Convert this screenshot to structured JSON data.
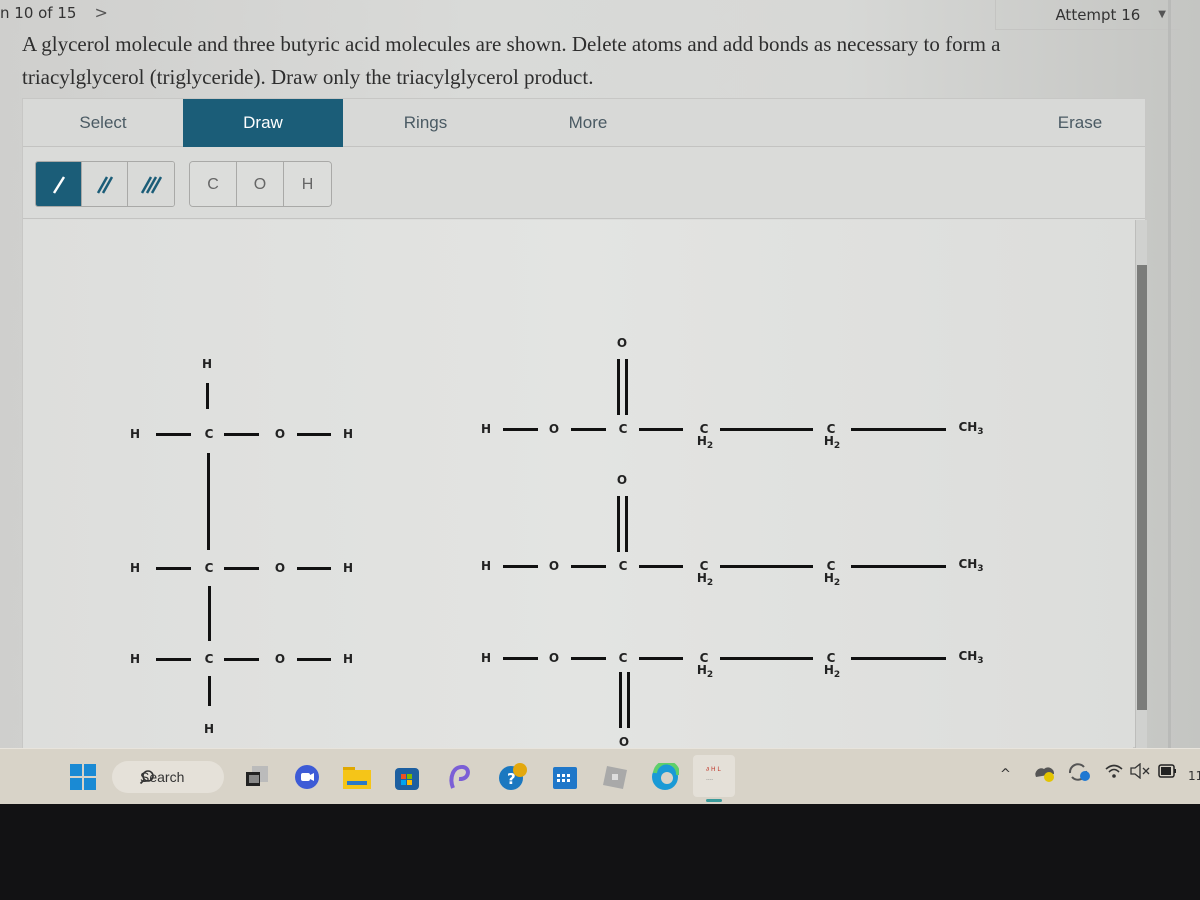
{
  "header": {
    "question_nav": "n 10 of 15",
    "next_icon": "chevron-right-icon",
    "attempt_label": "Attempt 16"
  },
  "prompt": {
    "text": "A glycerol molecule and three butyric acid molecules are shown. Delete atoms and add bonds as necessary to form a triacylglycerol (triglyceride). Draw only the triacylglycerol product."
  },
  "editor": {
    "tabs": [
      {
        "label": "Select",
        "active": false
      },
      {
        "label": "Draw",
        "active": true
      },
      {
        "label": "Rings",
        "active": false
      },
      {
        "label": "More",
        "active": false
      },
      {
        "label": "Erase",
        "active": false
      }
    ],
    "bond_tools": [
      "single-bond",
      "double-bond",
      "triple-bond"
    ],
    "active_bond_tool": "single-bond",
    "atom_tools": [
      "C",
      "O",
      "H"
    ],
    "accent_color": "#1b5d78"
  },
  "molecules": {
    "glycerol": {
      "rows": [
        {
          "left_H": "H",
          "C": "C",
          "O": "O",
          "right_H": "H"
        },
        {
          "left_H": "H",
          "C": "C",
          "O": "O",
          "right_H": "H"
        },
        {
          "left_H": "H",
          "C": "C",
          "O": "O",
          "right_H": "H"
        }
      ],
      "top_H": "H",
      "bottom_H": "H"
    },
    "butyric_acids": [
      {
        "H": "H",
        "O": "O",
        "C": "C",
        "carbonyl_O": "O",
        "ch2_a": "C",
        "ch2_a_h": "H",
        "ch2_b": "C",
        "ch2_b_h": "H",
        "ch3": "CH",
        "ch3_sub": "3",
        "h2_sub": "2"
      },
      {
        "H": "H",
        "O": "O",
        "C": "C",
        "carbonyl_O": "O",
        "ch2_a": "C",
        "ch2_a_h": "H",
        "ch2_b": "C",
        "ch2_b_h": "H",
        "ch3": "CH",
        "ch3_sub": "3",
        "h2_sub": "2"
      },
      {
        "H": "H",
        "O": "O",
        "C": "C",
        "carbonyl_O": "O",
        "ch2_a": "C",
        "ch2_a_h": "H",
        "ch2_b": "C",
        "ch2_b_h": "H",
        "ch3": "CH",
        "ch3_sub": "3",
        "h2_sub": "2"
      }
    ]
  },
  "taskbar": {
    "search_label": "Search",
    "apps": [
      "start-icon",
      "task-view-icon",
      "meet-icon",
      "file-explorer-icon",
      "store-icon",
      "copilot-icon",
      "help-icon",
      "calendar-icon",
      "roblox-icon",
      "edge-icon",
      "active-window-thumbnail"
    ],
    "tray": [
      "chevron-up-icon",
      "onedrive-icon",
      "sync-icon",
      "wifi-icon",
      "mute-icon",
      "battery-icon"
    ],
    "clock_partial": "11"
  }
}
